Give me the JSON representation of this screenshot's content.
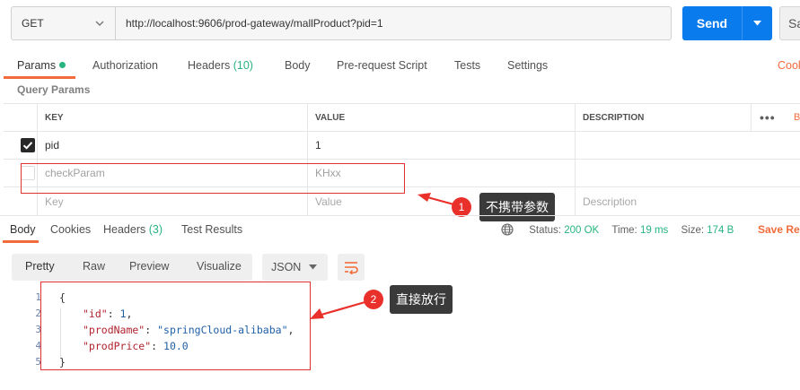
{
  "request": {
    "method": "GET",
    "url": "http://localhost:9606/prod-gateway/mallProduct?pid=1",
    "send_label": "Send",
    "save_label": "Sa"
  },
  "request_tabs": [
    {
      "label": "Params",
      "active": true
    },
    {
      "label": "Authorization"
    },
    {
      "label": "Headers ",
      "badge": "(10)"
    },
    {
      "label": "Body"
    },
    {
      "label": "Pre-request Script"
    },
    {
      "label": "Tests"
    },
    {
      "label": "Settings"
    }
  ],
  "cookies_label": "Cook",
  "query_params_title": "Query Params",
  "params_table": {
    "headers": {
      "key": "KEY",
      "value": "VALUE",
      "description": "DESCRIPTION"
    },
    "more_label": "•••",
    "bulk_label": "B",
    "rows": [
      {
        "checked": true,
        "key": "pid",
        "value": "1"
      },
      {
        "checked": false,
        "key": "checkParam",
        "value": "KHxx"
      }
    ],
    "placeholder": {
      "key": "Key",
      "value": "Value",
      "description": "Description"
    }
  },
  "annotations": [
    {
      "number": "1",
      "text": "不携带参数"
    },
    {
      "number": "2",
      "text": "直接放行"
    }
  ],
  "response_tabs": [
    {
      "label": "Body",
      "active": true
    },
    {
      "label": "Cookies"
    },
    {
      "label": "Headers ",
      "badge": "(3)"
    },
    {
      "label": "Test Results"
    }
  ],
  "response_status": {
    "status_label": "Status:",
    "status_value": "200 OK",
    "time_label": "Time:",
    "time_value": "19 ms",
    "size_label": "Size:",
    "size_value": "174 B",
    "save_response_label": "Save Res"
  },
  "view_modes": [
    "Pretty",
    "Raw",
    "Preview",
    "Visualize"
  ],
  "format_select": "JSON",
  "code_lines": [
    {
      "n": "1",
      "text": "{"
    },
    {
      "n": "2",
      "key": "\"id\"",
      "sep": ": ",
      "val": "1",
      "tail": ","
    },
    {
      "n": "3",
      "key": "\"prodName\"",
      "sep": ": ",
      "val": "\"springCloud-alibaba\"",
      "tail": ","
    },
    {
      "n": "4",
      "key": "\"prodPrice\"",
      "sep": ": ",
      "val": "10.0",
      "tail": ""
    },
    {
      "n": "5",
      "text": "}"
    }
  ],
  "colors": {
    "accent": "#f26b3a",
    "send": "#097bed",
    "success": "#26b47f",
    "annotation": "#e9302a"
  }
}
